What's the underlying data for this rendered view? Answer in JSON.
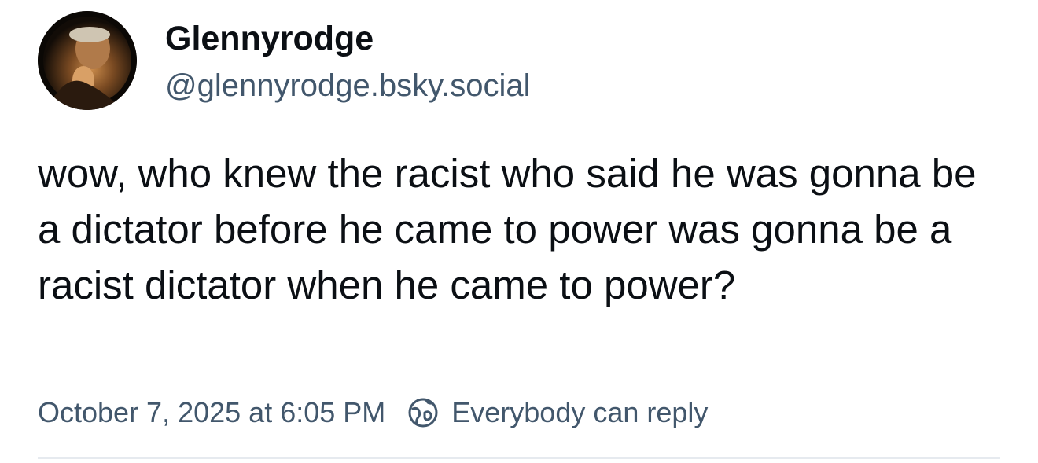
{
  "author": {
    "display_name": "Glennyrodge",
    "handle": "@glennyrodge.bsky.social",
    "avatar_icon": "user-avatar-photo"
  },
  "post": {
    "text": "wow, who knew the racist who said he was gonna be a dictator before he came to power was gonna be a racist dictator when he came to power?"
  },
  "meta": {
    "timestamp": "October 7, 2025 at 6:05 PM",
    "reply_icon": "globe-icon",
    "reply_setting": "Everybody can reply"
  },
  "colors": {
    "text": "#0b0f14",
    "secondary": "#42576c",
    "divider": "#e6eaef"
  }
}
